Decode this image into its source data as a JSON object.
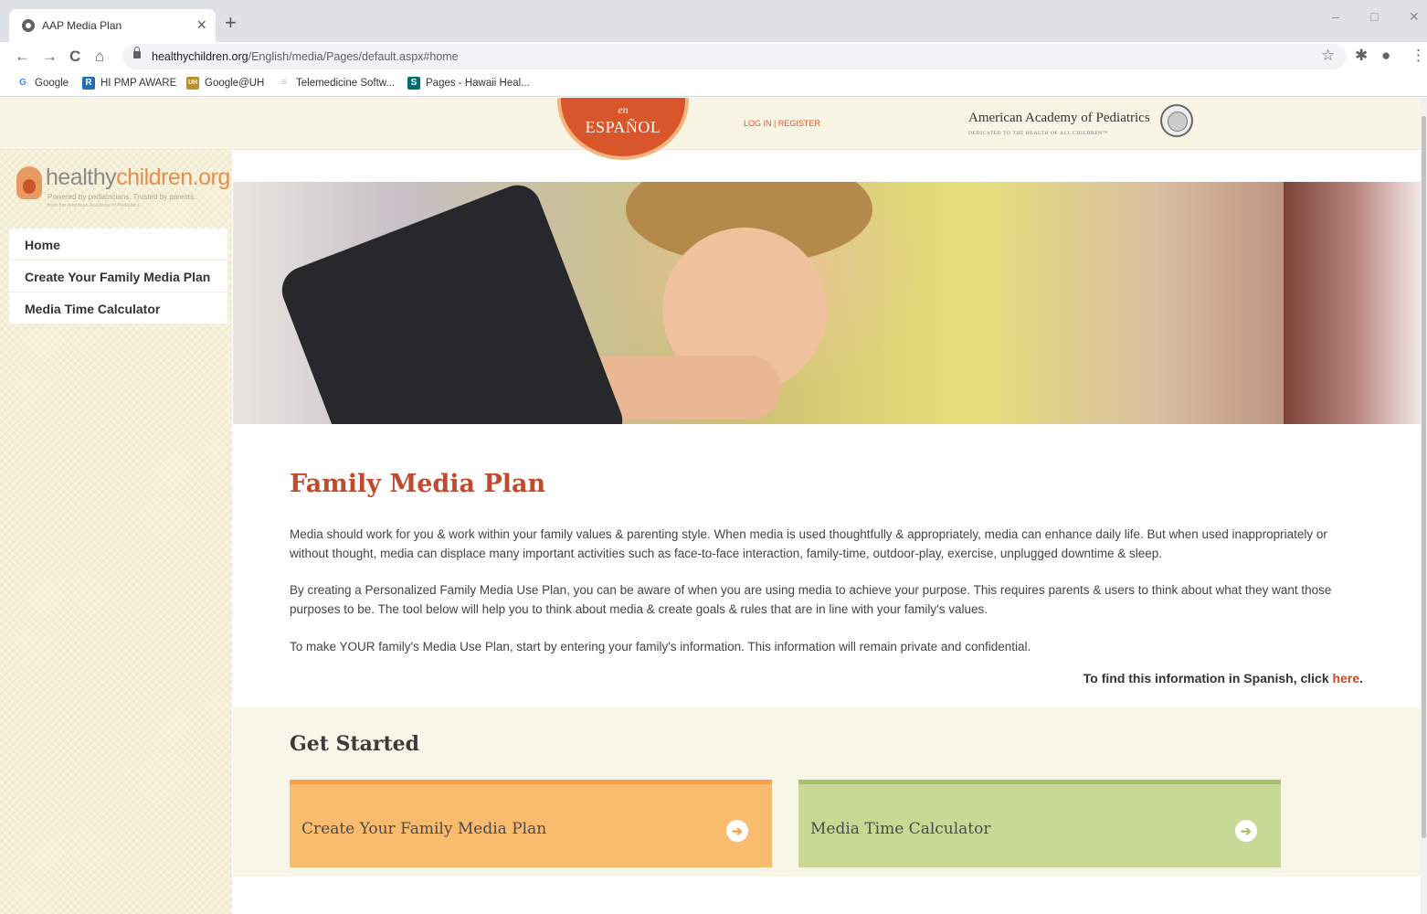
{
  "browser": {
    "tab_title": "AAP Media Plan",
    "tab_close": "×",
    "new_tab": "+",
    "win_minimize": "–",
    "win_maximize": "□",
    "win_close": "✕",
    "url_host": "healthychildren.org",
    "url_path": "/English/media/Pages/default.aspx#home",
    "nav_back": "←",
    "nav_forward": "→",
    "nav_reload": "C",
    "nav_home": "⌂",
    "star": "☆",
    "extensions": "✱",
    "profile": "●",
    "menu": "⋮",
    "bookmarks": [
      {
        "label": "Google",
        "icon": "G",
        "color": "#4285f4"
      },
      {
        "label": "HI PMP AWARE",
        "icon": "R",
        "color": "#1d6fb8"
      },
      {
        "label": "Google@UH",
        "icon": "UH",
        "color": "#b8902f"
      },
      {
        "label": "Telemedicine Softw...",
        "icon": "≡",
        "color": "#bbbbbb"
      },
      {
        "label": "Pages - Hawaii Heal...",
        "icon": "S",
        "color": "#036c70"
      }
    ]
  },
  "header": {
    "espanol_prefix": "en",
    "espanol_label": "ESPAÑOL",
    "login": "LOG IN | REGISTER",
    "aap_name": "American Academy of Pediatrics",
    "aap_tagline": "DEDICATED TO THE HEALTH OF ALL CHILDREN™"
  },
  "sidebar": {
    "logo_healthy": "healthy",
    "logo_children": "children.org",
    "logo_tagline": "Powered by pediatricians. Trusted by parents.",
    "logo_subtagline": "from the American Academy of Pediatrics",
    "items": [
      {
        "label": "Home"
      },
      {
        "label": "Create Your Family Media Plan"
      },
      {
        "label": "Media Time Calculator"
      }
    ]
  },
  "main": {
    "title": "Family Media Plan",
    "paragraphs": [
      "Media should work for you & work within your family values & parenting style. When media is used thoughtfully & appropriately, media can enhance daily life. But when used inappropriately or without thought, media can displace many important activities such as face-to-face interaction, family-time, outdoor-play, exercise, unplugged downtime & sleep.",
      "By creating a Personalized Family Media Use Plan, you can be aware of when you are using media to achieve your purpose. This requires parents & users to think about what they want those purposes to be. The tool below will help you to think about media & create goals & rules that are in line with your family's values.",
      "To make YOUR family's Media Use Plan, start by entering your family's information. This information will remain private and confidential."
    ],
    "spanish_note": "To find this information in Spanish, click",
    "spanish_link": "here",
    "spanish_period": "."
  },
  "get_started": {
    "title": "Get Started",
    "cards": [
      {
        "label": "Create Your Family Media Plan",
        "arrow": "➔"
      },
      {
        "label": "Media Time Calculator",
        "arrow": "➔"
      }
    ]
  },
  "colors": {
    "accent": "#c24a2c",
    "orange_card": "#f9bb6e",
    "green_card": "#c8d996",
    "sidebar_bg": "#f5f0d7"
  }
}
